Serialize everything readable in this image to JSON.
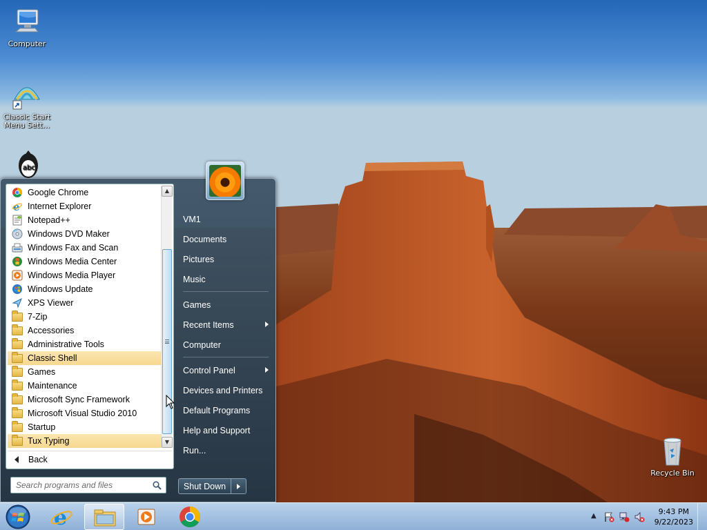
{
  "desktop": {
    "icons": [
      {
        "label": "Computer",
        "icon": "computer-icon"
      },
      {
        "label": "Classic Start Menu Sett...",
        "icon": "classic-shell-icon"
      },
      {
        "label": "",
        "icon": "tux-typing-icon"
      },
      {
        "label": "Recycle Bin",
        "icon": "recycle-bin-icon"
      }
    ]
  },
  "start_menu": {
    "programs": [
      {
        "label": "Google Chrome",
        "icon": "chrome-icon"
      },
      {
        "label": "Internet Explorer",
        "icon": "ie-icon"
      },
      {
        "label": "Notepad++",
        "icon": "notepad-plus-plus-icon"
      },
      {
        "label": "Windows DVD Maker",
        "icon": "dvd-maker-icon"
      },
      {
        "label": "Windows Fax and Scan",
        "icon": "fax-scan-icon"
      },
      {
        "label": "Windows Media Center",
        "icon": "media-center-icon"
      },
      {
        "label": "Windows Media Player",
        "icon": "media-player-icon"
      },
      {
        "label": "Windows Update",
        "icon": "windows-update-icon"
      },
      {
        "label": "XPS Viewer",
        "icon": "xps-viewer-icon"
      },
      {
        "label": "7-Zip",
        "icon": "folder-icon"
      },
      {
        "label": "Accessories",
        "icon": "folder-icon"
      },
      {
        "label": "Administrative Tools",
        "icon": "folder-icon"
      },
      {
        "label": "Classic Shell",
        "icon": "folder-icon",
        "highlighted": true
      },
      {
        "label": "Games",
        "icon": "folder-icon"
      },
      {
        "label": "Maintenance",
        "icon": "folder-icon"
      },
      {
        "label": "Microsoft Sync Framework",
        "icon": "folder-icon"
      },
      {
        "label": "Microsoft Visual Studio 2010",
        "icon": "folder-icon"
      },
      {
        "label": "Startup",
        "icon": "folder-icon"
      },
      {
        "label": "Tux Typing",
        "icon": "folder-icon",
        "highlighted": true
      }
    ],
    "back_label": "Back",
    "search_placeholder": "Search programs and files",
    "right_items": [
      {
        "label": "VM1",
        "submenu": false
      },
      {
        "label": "Documents",
        "submenu": false
      },
      {
        "label": "Pictures",
        "submenu": false
      },
      {
        "label": "Music",
        "submenu": false
      },
      {
        "separator": true
      },
      {
        "label": "Games",
        "submenu": false
      },
      {
        "label": "Recent Items",
        "submenu": true
      },
      {
        "label": "Computer",
        "submenu": false
      },
      {
        "separator": true
      },
      {
        "label": "Control Panel",
        "submenu": true
      },
      {
        "label": "Devices and Printers",
        "submenu": false
      },
      {
        "label": "Default Programs",
        "submenu": false
      },
      {
        "label": "Help and Support",
        "submenu": false
      },
      {
        "label": "Run...",
        "submenu": false
      }
    ],
    "shutdown_label": "Shut Down"
  },
  "taskbar": {
    "pinned": [
      {
        "icon": "internet-explorer-icon",
        "active": false
      },
      {
        "icon": "windows-explorer-icon",
        "active": true
      },
      {
        "icon": "windows-media-player-icon",
        "active": false
      },
      {
        "icon": "google-chrome-icon",
        "active": false
      }
    ],
    "clock": {
      "time": "9:43 PM",
      "date": "9/22/2023"
    }
  },
  "colors": {
    "highlight": "#f7d88f",
    "menu_dark": "#2c4152",
    "taskbar": "#a6c3e3"
  }
}
